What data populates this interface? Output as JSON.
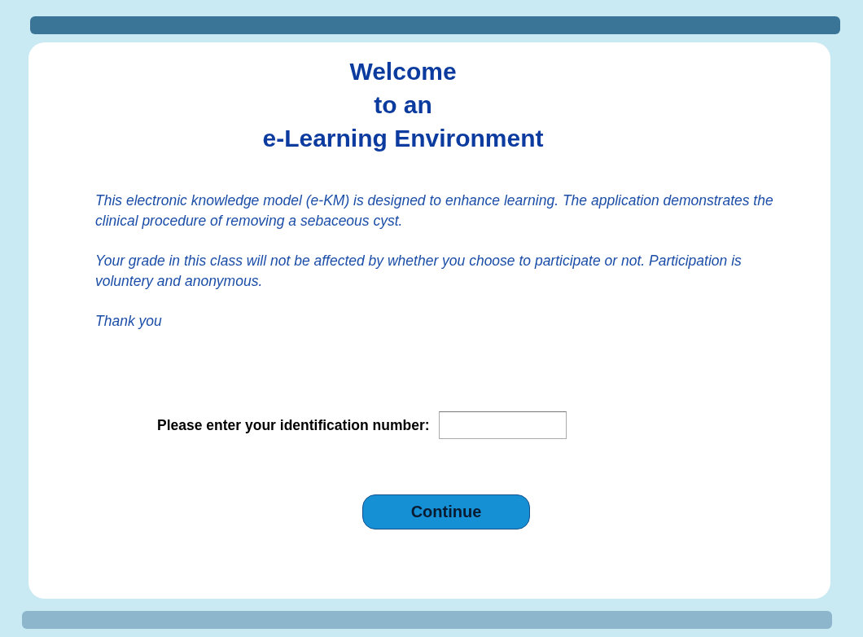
{
  "title_lines": [
    "Welcome",
    "to an",
    "e-Learning Environment"
  ],
  "paragraphs": [
    "This electronic knowledge model (e-KM) is designed to enhance learning. The application demonstrates the clinical procedure of removing a sebaceous cyst.",
    "Your grade in this class will not be affected by whether you choose to participate or not. Participation is voluntery and anonymous.",
    "Thank you"
  ],
  "id_form": {
    "label": "Please enter your identification number:"
  },
  "continue_button": {
    "label": "Continue"
  }
}
